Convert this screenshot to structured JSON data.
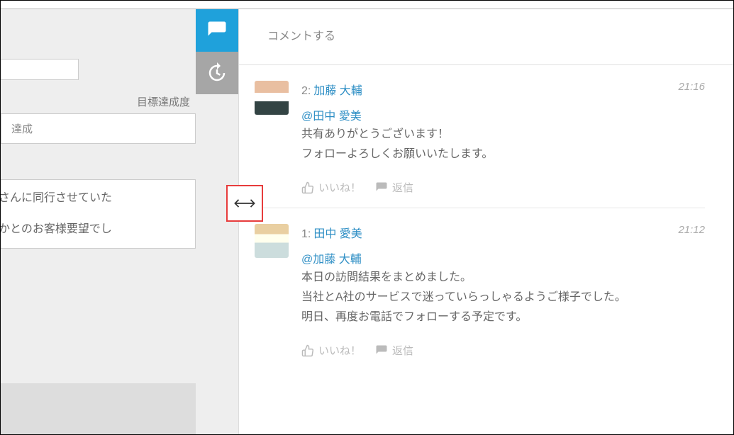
{
  "left": {
    "goal_label": "目標達成度",
    "goal_value": "達成",
    "text_line_1": "さんに同行させていた",
    "text_line_2": "かとのお客様要望でし"
  },
  "compose": {
    "placeholder": "コメントする"
  },
  "comments": [
    {
      "num": "2:",
      "author": "加藤 大輔",
      "time": "21:16",
      "mention": "@田中 愛美",
      "text": "共有ありがとうございます！\nフォローよろしくお願いいたします。"
    },
    {
      "num": "1:",
      "author": "田中 愛美",
      "time": "21:12",
      "mention": "@加藤 大輔",
      "text": "本日の訪問結果をまとめました。\n当社とA社のサービスで迷っていらっしゃるようご様子でした。\n明日、再度お電話でフォローする予定です。"
    }
  ],
  "actions": {
    "like": "いいね！",
    "reply": "返信"
  }
}
